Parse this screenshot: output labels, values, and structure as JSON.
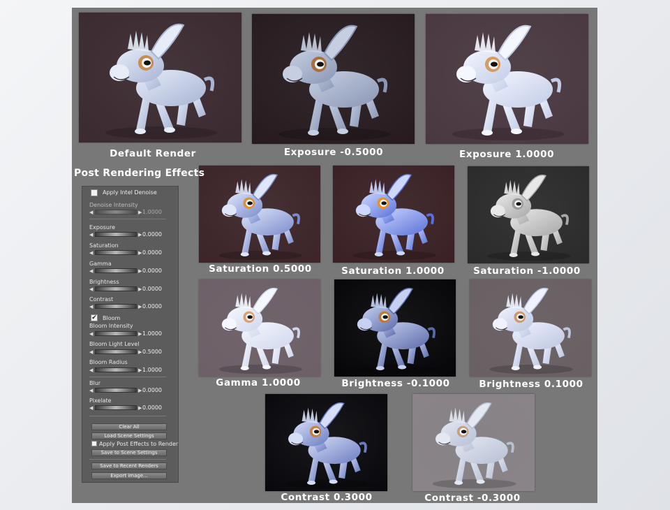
{
  "renders": [
    {
      "key": "default",
      "caption": "Default Render",
      "bg": "#3b2a30",
      "fig": "#a8b4d4",
      "hi": "#e6ecf8",
      "eye": "#c88c50"
    },
    {
      "key": "exp_neg",
      "caption": "Exposure  -0.5000",
      "bg": "#261a1e",
      "fig": "#8a96b4",
      "hi": "#c6cfe2",
      "eye": "#a87040"
    },
    {
      "key": "exp_pos",
      "caption": "Exposure  1.0000",
      "bg": "#4a3840",
      "fig": "#c2cce6",
      "hi": "#f4f7ff",
      "eye": "#d89a60"
    },
    {
      "key": "sat_half",
      "caption": "Saturation  0.5000",
      "bg": "#3c2428",
      "fig": "#7a8ccc",
      "hi": "#dfe6fa",
      "eye": "#e09030"
    },
    {
      "key": "sat_full",
      "caption": "Saturation  1.0000",
      "bg": "#3a2024",
      "fig": "#5a70d8",
      "hi": "#cdd8ff",
      "eye": "#f0901c"
    },
    {
      "key": "sat_neg",
      "caption": "Saturation  -1.0000",
      "bg": "#2a2a2a",
      "fig": "#a8a8a8",
      "hi": "#e8e8e8",
      "eye": "#999999"
    },
    {
      "key": "gamma",
      "caption": "Gamma  1.0000",
      "bg": "#6e6068",
      "fig": "#cfd7ec",
      "hi": "#f6f8ff",
      "eye": "#d8a070"
    },
    {
      "key": "bright_neg",
      "caption": "Brightness  -0.1000",
      "bg": "#050508",
      "fig": "#5a6aa8",
      "hi": "#c6d0f0",
      "eye": "#c07a38"
    },
    {
      "key": "bright_pos",
      "caption": "Brightness  0.1000",
      "bg": "#6a6064",
      "fig": "#bcc6e0",
      "hi": "#f0f3ff",
      "eye": "#d09868"
    },
    {
      "key": "con_pos",
      "caption": "Contrast  0.3000",
      "bg": "#08080c",
      "fig": "#6a7cc0",
      "hi": "#d6ddf6",
      "eye": "#c68040"
    },
    {
      "key": "con_neg",
      "caption": "Contrast  -0.3000",
      "bg": "#8a8488",
      "fig": "#b6bfd4",
      "hi": "#e4e8f2",
      "eye": "#c6a080"
    }
  ],
  "section_title": "Post Rendering Effects",
  "panel": {
    "denoise_checkbox": "Apply Intel Denoise",
    "denoise_checked": false,
    "denoise_intensity": {
      "label": "Denoise Intensity",
      "value": "1.0000"
    },
    "sliders": [
      {
        "label": "Exposure",
        "value": "0.0000"
      },
      {
        "label": "Saturation",
        "value": "0.0000"
      },
      {
        "label": "Gamma",
        "value": "0.0000"
      },
      {
        "label": "Brightness",
        "value": "0.0000"
      },
      {
        "label": "Contrast",
        "value": "0.0000"
      }
    ],
    "bloom_checkbox": "Bloom",
    "bloom_checked": true,
    "bloom_sliders": [
      {
        "label": "Bloom Intensity",
        "value": "1.0000"
      },
      {
        "label": "Bloom Light Level",
        "value": "0.5000"
      },
      {
        "label": "Bloom Radius",
        "value": "1.0000"
      }
    ],
    "effect_sliders": [
      {
        "label": "Blur",
        "value": "0.0000"
      },
      {
        "label": "Pixelate",
        "value": "0.0000"
      }
    ],
    "clear_all": "Clear All",
    "load_scene": "Load Scene Settings",
    "apply_post_checkbox": "Apply Post Effects to Render",
    "save_scene": "Save to Scene Settings",
    "save_recent": "Save to Recent Renders",
    "export_image": "Export image..."
  }
}
